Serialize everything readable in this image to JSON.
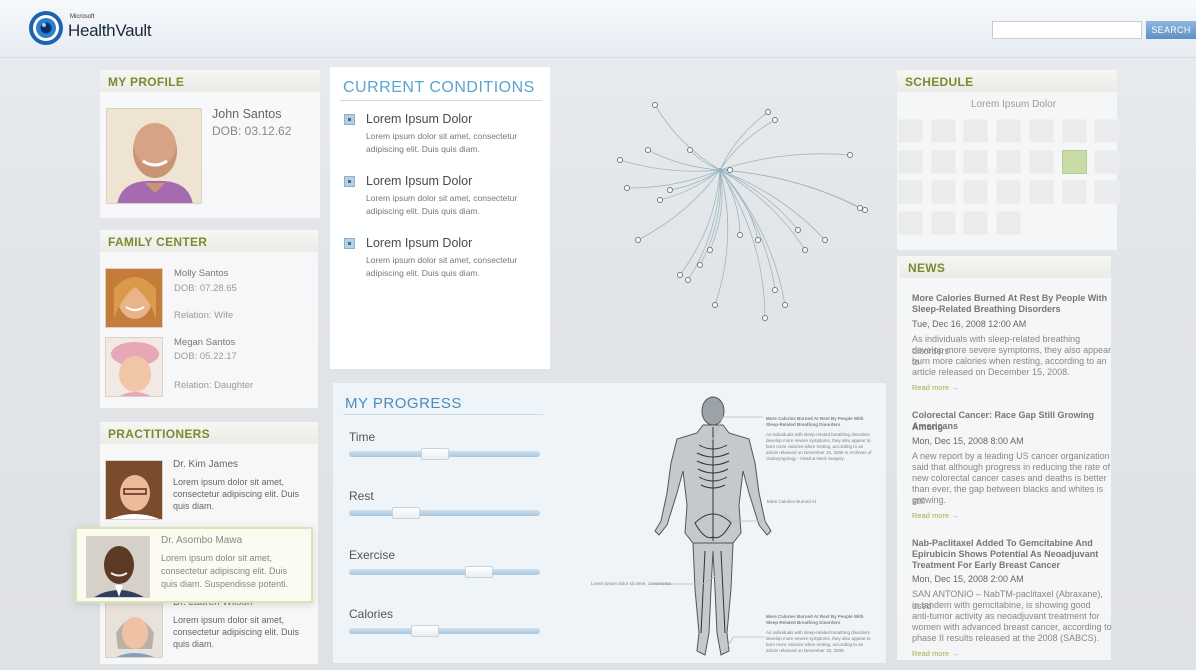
{
  "app": {
    "logo_small": "Microsoft",
    "logo_name": "HealthVault",
    "search_placeholder": "",
    "search_button": "SEARCH"
  },
  "profile": {
    "header": "MY PROFILE",
    "name": "John Santos",
    "dob": "DOB: 03.12.62"
  },
  "family": {
    "header": "FAMILY CENTER",
    "members": [
      {
        "name": "Molly Santos",
        "dob": "DOB: 07.28.65",
        "relation": "Relation: Wife"
      },
      {
        "name": "Megan Santos",
        "dob": "DOB: 05.22.17",
        "relation": "Relation: Daughter"
      }
    ]
  },
  "practitioners": {
    "header": "PRACTITIONERS",
    "items": [
      {
        "name": "Dr. Kim James",
        "desc1": "Lorem ipsum dolor sit amet,",
        "desc2": "consectetur adipiscing elit. Duis",
        "desc3": "quis diam."
      },
      {
        "name": "Dr. Asombo Mawa",
        "desc1": "Lorem ipsum dolor sit amet,",
        "desc2": "consectetur adipiscing elit. Duis",
        "desc3": "quis diam. Suspendisse potenti."
      },
      {
        "name": "Dr. Lauren Wilson",
        "desc1": "Lorem ipsum dolor sit amet,",
        "desc2": "consectetur adipiscing elit. Duis",
        "desc3": "quis diam."
      }
    ]
  },
  "conditions": {
    "header": "CURRENT CONDITIONS",
    "items": [
      {
        "name": "Lorem Ipsum Dolor",
        "desc1": "Lorem ipsum dolor sit amet, consectetur",
        "desc2": "adipiscing elit. Duis quis diam."
      },
      {
        "name": "Lorem Ipsum Dolor",
        "desc1": "Lorem ipsum dolor sit amet, consectetur",
        "desc2": "adipiscing elit. Duis quis diam."
      },
      {
        "name": "Lorem Ipsum Dolor",
        "desc1": "Lorem ipsum dolor sit amet, consectetur",
        "desc2": "adipiscing elit. Duis quis diam."
      }
    ]
  },
  "progress": {
    "header": "MY PROGRESS",
    "sliders": [
      {
        "label": "Time",
        "value": 0.45
      },
      {
        "label": "Rest",
        "value": 0.3
      },
      {
        "label": "Exercise",
        "value": 0.68
      },
      {
        "label": "Calories",
        "value": 0.4
      }
    ],
    "body_notes": {
      "n1_title": "More Calories Burned At Rest By People With Sleep-Related Breathing Disorders",
      "n1_body": "As individuals with sleep-related breathing disorders develop more severe symptoms, they also appear to burn more calories when resting, according to an article released on December 15, 2008 in Archives of Otolaryngology - Head & Neck Surgery.",
      "n2": "More Calories Burned At",
      "n3": "Lorem ipsum dolor sit amet, consectetur.",
      "n4_title": "More Calories Burned At Rest By People With Sleep-Related Breathing Disorders",
      "n4_body": "As individuals with sleep-related breathing disorders develop more severe symptoms, they also appear to burn more calories when resting, according to an article released on December 15, 2008."
    }
  },
  "schedule": {
    "header": "SCHEDULE",
    "month": "Lorem Ipsum Dolor",
    "cells": 25,
    "highlight_index": 12
  },
  "news": {
    "header": "NEWS",
    "read_more": "Read more →",
    "items": [
      {
        "title1": "More Calories Burned At Rest By People With",
        "title2": "Sleep-Related Breathing Disorders",
        "date": "Tue, Dec 16, 2008 12:00 AM",
        "b1": "As individuals with sleep-related breathing disorders",
        "b2": "develop more severe symptoms, they also appear to",
        "b3": "burn more calories when resting, according to an",
        "b4": "article released on December 15, 2008."
      },
      {
        "title1": "Colorectal Cancer: Race Gap Still Growing Among",
        "title2": "Americans",
        "date": "Mon, Dec 15, 2008 8:00 AM",
        "b1": "A new report by a leading US cancer organization",
        "b2": "said that although progress in reducing the rate of",
        "b3": "new colorectal cancer cases and deaths is better",
        "b4": "than ever, the gap between blacks and whites is still",
        "b5": "growing."
      },
      {
        "title1": "Nab-Paclitaxel Added To Gemcitabine And",
        "title2": "Epirubicin Shows Potential As Neoadjuvant",
        "title3": "Treatment For Early Breast Cancer",
        "date": "Mon, Dec 15, 2008 2:00 AM",
        "b1": "SAN ANTONIO  –  NabTM-paclitaxel (Abraxane), used",
        "b2": "in tandem with gemcitabine, is showing good",
        "b3": "anti-tumor activity as neoadjuvant treatment for",
        "b4": "women with advanced breast cancer, according to",
        "b5": "phase II results released at the 2008 (SABCS)."
      }
    ]
  },
  "colors": {
    "header_green": "#7b8b2f",
    "blue_title": "#5aa4cf",
    "accent_highlight": "#c9dca7",
    "node_line": "#7fb6c8"
  }
}
